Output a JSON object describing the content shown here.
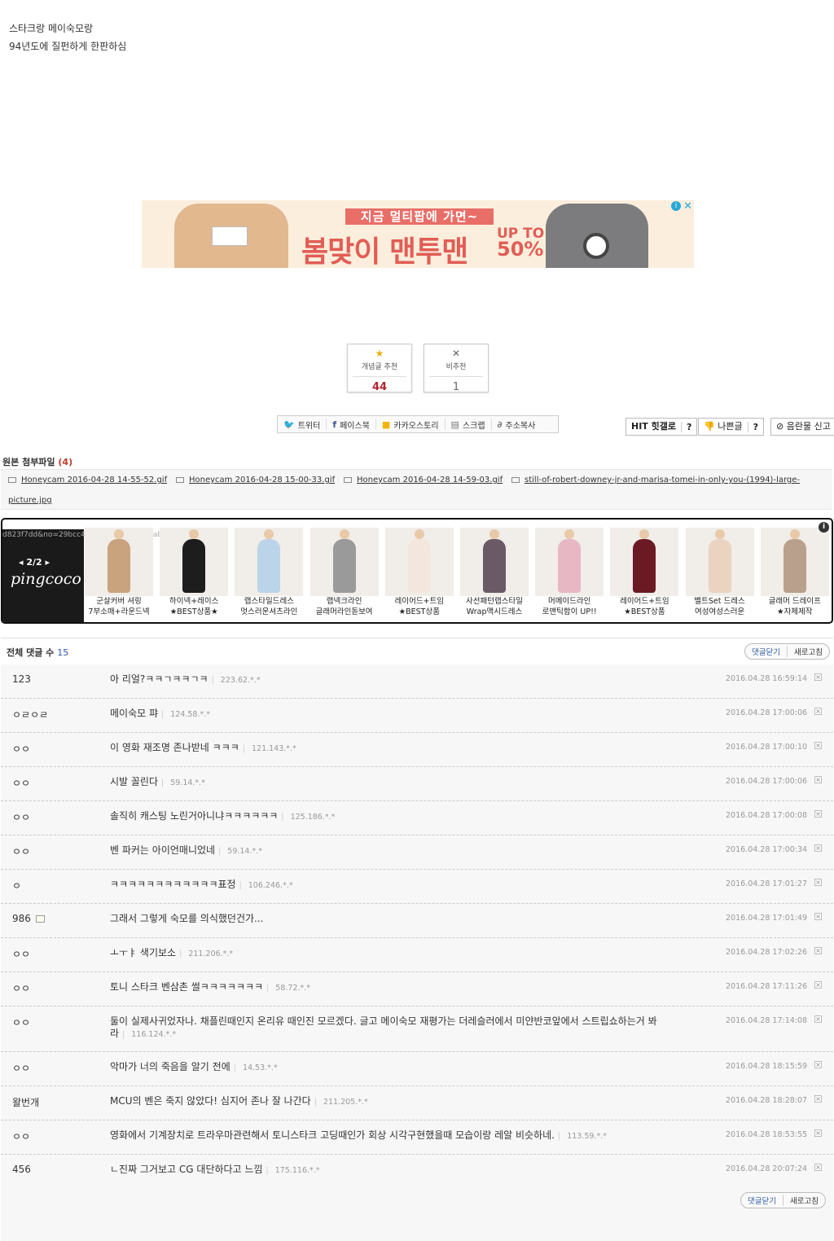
{
  "post": {
    "lines": [
      "스타크랑 메이숙모랑",
      "94년도에 질펀하게 한판하심"
    ]
  },
  "ad_banner": {
    "top_text": "지금 멀티팝에 가면~",
    "main_text": "봄맞이 맨투맨",
    "sale_line1": "UP TO",
    "sale_line2": "50%",
    "accent_color": "#e25d55"
  },
  "votes": {
    "up_label": "개념글 추천",
    "up_count": "44",
    "down_label": "비추천",
    "down_count": "1"
  },
  "share": {
    "twitter": "트위터",
    "facebook": "페이스북",
    "kakaostory": "카카오스토리",
    "scrap": "스크랩",
    "copy_url": "주소복사"
  },
  "utils": {
    "hit_gallery": "HIT 힛갤로",
    "bad_post": "나쁜글",
    "obscene_report": "음란물 신고",
    "help": "?"
  },
  "attachments": {
    "title": "원본 첨부파일",
    "count": "(4)",
    "files": [
      "Honeycam 2016-04-28 14-55-52.gif",
      "Honeycam 2016-04-28 15-00-33.gif",
      "Honeycam 2016-04-28 14-59-03.gif",
      "still-of-robert-downey-jr-and-marisa-tomei-in-only-you-(1994)-large-",
      "picture.jpg"
    ]
  },
  "product_ad": {
    "url_fragment": "d823f7dd&no=29bcc427b38477a16fb3dab004c8...",
    "pager": "2/2",
    "brand": "pingcoco",
    "items": [
      {
        "line1": "군살커버 셔링",
        "line2": "7부소매+라운드넥",
        "color": "#c9a27e"
      },
      {
        "line1": "하이넥+레이스",
        "line2": "★BEST상품★",
        "color": "#1d1d1d"
      },
      {
        "line1": "랩스타일드레스",
        "line2": "멋스러운셔츠라인",
        "color": "#bcd4ea"
      },
      {
        "line1": "랩넥크라인",
        "line2": "글래머라인돋보여",
        "color": "#9a9a9a"
      },
      {
        "line1": "레이어드+트임",
        "line2": "★BEST상품",
        "color": "#f3e6dc"
      },
      {
        "line1": "사선패턴랩스타일",
        "line2": "Wrap맥시드레스",
        "color": "#6a5a66"
      },
      {
        "line1": "머메이드라인",
        "line2": "로맨틱함이 UP!!",
        "color": "#e7b8c4"
      },
      {
        "line1": "레이어드+트임",
        "line2": "★BEST상품",
        "color": "#6b1a24"
      },
      {
        "line1": "벨트Set 드레스",
        "line2": "여성여성스러운",
        "color": "#ead3c1"
      },
      {
        "line1": "글래머 드레이프",
        "line2": "★자체제작",
        "color": "#b8a08c"
      }
    ]
  },
  "comments": {
    "title": "전체 댓글 수",
    "count": "15",
    "close_label": "댓글닫기",
    "refresh_label": "새로고침",
    "items": [
      {
        "name": "123",
        "text": "아 리얼?ㅋㅋㄱㅋㅋㄱㅋ",
        "ip": "223.62.*.*",
        "date": "2016.04.28 16:59:14"
      },
      {
        "name": "ㅇㄹㅇㄹ",
        "text": "메이숙모 퍄",
        "ip": "124.58.*.*",
        "date": "2016.04.28 17:00:06"
      },
      {
        "name": "ㅇㅇ",
        "text": "이 영화 재조명 존나받네 ㅋㅋㅋ",
        "ip": "121.143.*.*",
        "date": "2016.04.28 17:00:10"
      },
      {
        "name": "ㅇㅇ",
        "text": "시발 꼴린다",
        "ip": "59.14.*.*",
        "date": "2016.04.28 17:00:06"
      },
      {
        "name": "ㅇㅇ",
        "text": "솔직히 캐스팅 노린거아니냐ㅋㅋㅋㅋㅋㅋ",
        "ip": "125.186.*.*",
        "date": "2016.04.28 17:00:08"
      },
      {
        "name": "ㅇㅇ",
        "text": "벤 파커는 아이언매니었네",
        "ip": "59.14.*.*",
        "date": "2016.04.28 17:00:34"
      },
      {
        "name": "ㅇ",
        "text": "ㅋㅋㅋㅋㅋㅋㅋㅋㅋㅋㅋㅋ표정",
        "ip": "106.246.*.*",
        "date": "2016.04.28 17:01:27"
      },
      {
        "name": "986",
        "text": "그래서 그렇게 숙모를 의식했던건가...",
        "ip": "",
        "date": "2016.04.28 17:01:49"
      },
      {
        "name": "ㅇㅇ",
        "text": "ㅗㅜㅑ 색기보소",
        "ip": "211.206.*.*",
        "date": "2016.04.28 17:02:26"
      },
      {
        "name": "ㅇㅇ",
        "text": "토니 스타크 벤삼촌 썰ㅋㅋㅋㅋㅋㅋㅋ",
        "ip": "58.72.*.*",
        "date": "2016.04.28 17:11:26"
      },
      {
        "name": "ㅇㅇ",
        "text": "둘이 실제사귀었자나. 채플린때인지 온리유 때인진 모르겠다. 글고 메이숙모 재평가는 더레슬러에서 미얀반코앞에서 스트립쇼하는거 봐라",
        "ip": "116.124.*.*",
        "date": "2016.04.28 17:14:08"
      },
      {
        "name": "ㅇㅇ",
        "text": "악마가 너의 죽음을 알기 전에",
        "ip": "14.53.*.*",
        "date": "2016.04.28 18:15:59"
      },
      {
        "name": "왈번개",
        "text": "MCU의 벤은 죽지 않았다! 심지어 존나 잘 나간다",
        "ip": "211.205.*.*",
        "date": "2016.04.28 18:28:07"
      },
      {
        "name": "ㅇㅇ",
        "text": "영화에서 기계장치로 트라우마관련해서 토니스타크 고딩때인가 회상 시각구현했을때 모습이랑 레알 비슷하네.",
        "ip": "113.59.*.*",
        "date": "2016.04.28 18:53:55"
      },
      {
        "name": "456",
        "text": "ㄴ진짜 그거보고 CG 대단하다고 느낌",
        "ip": "175.116.*.*",
        "date": "2016.04.28 20:07:24"
      }
    ]
  }
}
